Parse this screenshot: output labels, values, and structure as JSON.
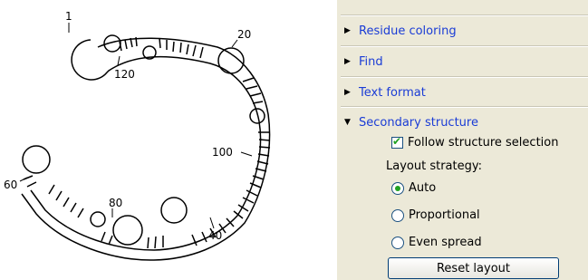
{
  "diagram": {
    "numbers": {
      "n1": "1",
      "n20": "20",
      "n120": "120",
      "n100": "100",
      "n60": "60",
      "n80": "80",
      "n40": "40"
    }
  },
  "panel": {
    "sections": [
      {
        "label": "Residue coloring",
        "expanded": false
      },
      {
        "label": "Find",
        "expanded": false
      },
      {
        "label": "Text format",
        "expanded": false
      },
      {
        "label": "Secondary structure",
        "expanded": true
      }
    ],
    "follow_structure": {
      "label": "Follow structure selection",
      "checked": true
    },
    "layout_strategy": {
      "label": "Layout strategy:",
      "options": [
        {
          "label": "Auto",
          "selected": true
        },
        {
          "label": "Proportional",
          "selected": false
        },
        {
          "label": "Even spread",
          "selected": false
        }
      ]
    },
    "reset_button": "Reset layout"
  },
  "icons": {
    "collapsed": "triangle-right-icon",
    "expanded": "triangle-down-icon",
    "check": "checkmark-icon"
  },
  "colors": {
    "link": "#1a3cd6",
    "panel_bg": "#ece9d8",
    "check_green": "#21a121"
  }
}
